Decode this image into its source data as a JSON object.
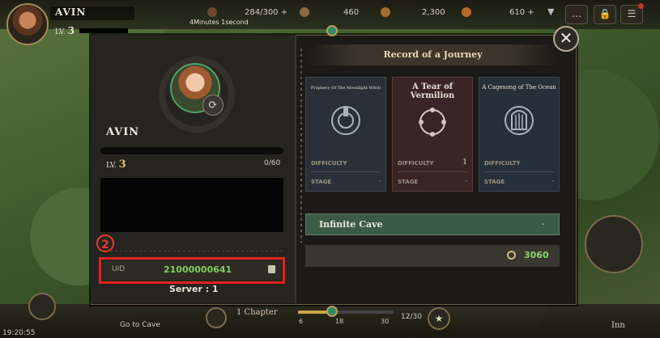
{
  "hud": {
    "player_name": "AVIN",
    "level_prefix": "LV.",
    "level": "3",
    "stamina": "284/300 +",
    "timer_caption": "4Minutes 1second",
    "resource_1": "460",
    "resource_2": "2,300",
    "gems": "610 +"
  },
  "bottom": {
    "clock": "19:20:55",
    "go_cave": "Go to Cave",
    "chapter": "1 Chapter",
    "progress_ticks": [
      "6",
      "18",
      "30"
    ],
    "progress_fraction": 0.4,
    "stars": "12/30",
    "inn": "Inn"
  },
  "profile": {
    "name": "AVIN",
    "level_prefix": "LV.",
    "level": "3",
    "xp": "0/60",
    "marker": "2",
    "uid_label": "UID",
    "uid": "21000000641",
    "server": "Server : 1"
  },
  "record": {
    "title": "Record of a Journey",
    "cards": [
      {
        "title": "Prophecy Of The Moonlight Witch",
        "difficulty_label": "DIFFICULTY",
        "difficulty": "",
        "stage_label": "STAGE",
        "stage": "-",
        "color": "#2a3038"
      },
      {
        "title": "A Tear of Vermilion",
        "difficulty_label": "DIFFICULTY",
        "difficulty": "1",
        "stage_label": "STAGE",
        "stage": "-",
        "color": "#3a2426"
      },
      {
        "title": "A Cagesong of The Ocean",
        "difficulty_label": "DIFFICULTY",
        "difficulty": "",
        "stage_label": "STAGE",
        "stage": "-",
        "color": "#263039"
      }
    ],
    "cave_label": "Infinite Cave",
    "cave_value": "-",
    "score": "3060"
  },
  "colors": {
    "accent_green": "#7fd05a",
    "highlight_red": "#e0241c",
    "gold": "#e3c064"
  }
}
